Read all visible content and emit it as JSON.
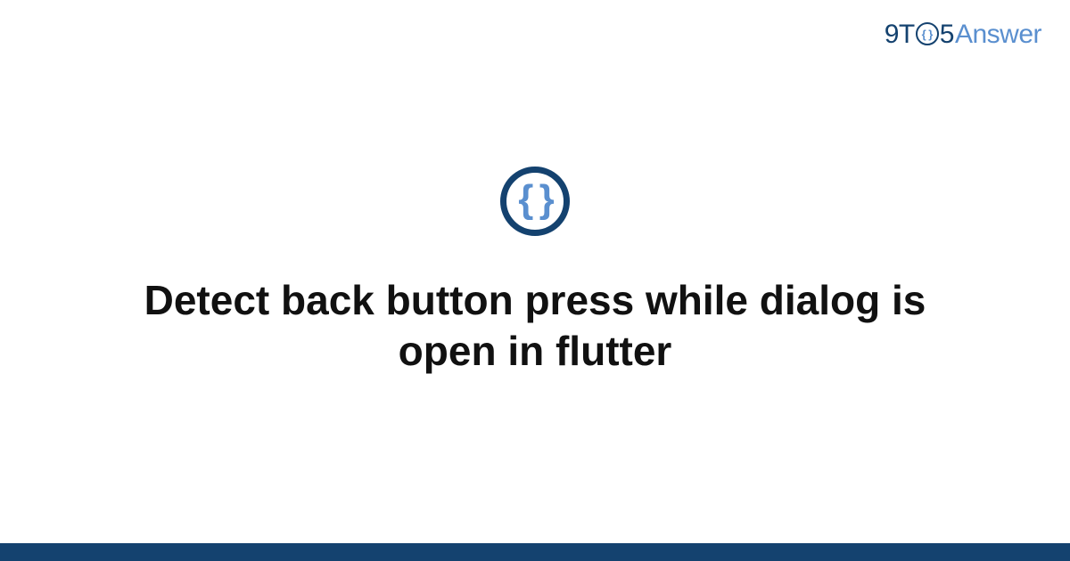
{
  "brand": {
    "part1": "9T",
    "circle_glyph": "{ }",
    "part2": "5",
    "part3": "Answer"
  },
  "icon": {
    "glyph": "{ }"
  },
  "title": "Detect back button press while dialog is open in flutter",
  "colors": {
    "dark_blue": "#14426f",
    "light_blue": "#5a8fcf",
    "text": "#111111",
    "background": "#ffffff"
  }
}
